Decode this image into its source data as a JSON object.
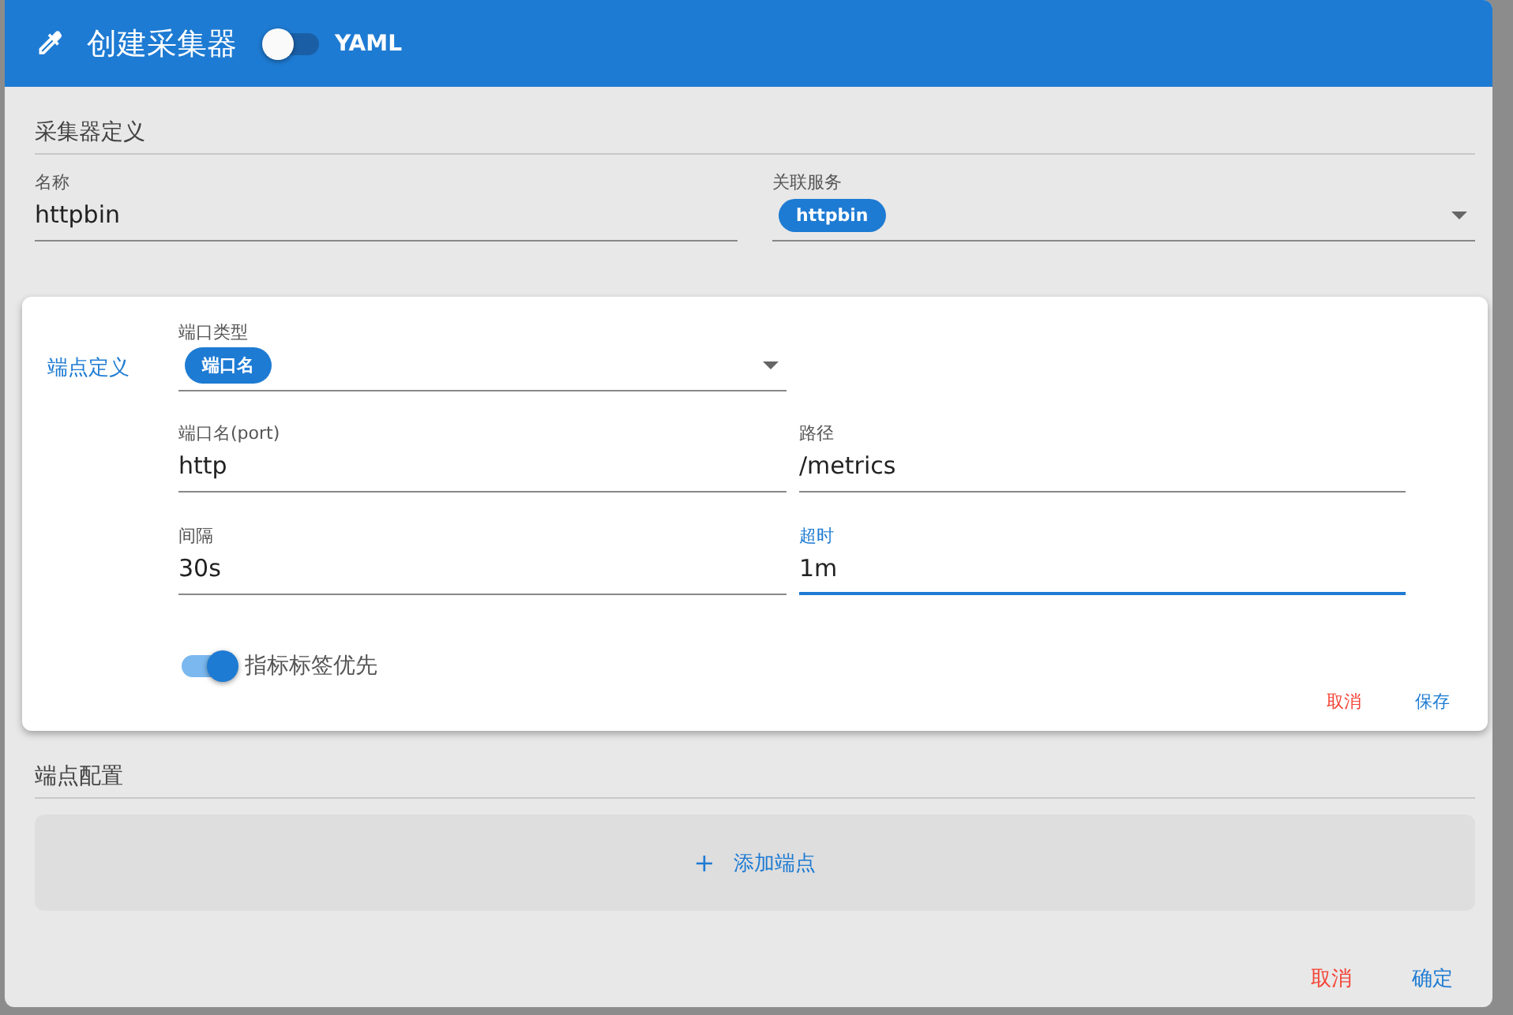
{
  "dialog": {
    "title": "创建采集器",
    "yaml_toggle": {
      "label": "YAML",
      "on": false
    }
  },
  "definition": {
    "heading": "采集器定义",
    "fields": [
      {
        "label": "名称",
        "value": "httpbin",
        "kind": "text"
      },
      {
        "label": "关联服务",
        "kind": "select",
        "chips": [
          "httpbin"
        ]
      }
    ]
  },
  "endpoint_card": {
    "label": "端点定义",
    "port_type": {
      "label": "端口类型",
      "chips": [
        "端口名"
      ]
    },
    "fields": [
      {
        "label": "端口名(port)",
        "value": "http",
        "focused": false
      },
      {
        "label": "路径",
        "value": "/metrics",
        "focused": false
      },
      {
        "label": "间隔",
        "value": "30s",
        "focused": false
      },
      {
        "label": "超时",
        "value": "1m",
        "focused": true
      }
    ],
    "switch": {
      "label": "指标标签优先",
      "on": true
    },
    "buttons": [
      {
        "label": "取消",
        "kind": "cancel"
      },
      {
        "label": "保存",
        "kind": "primary"
      }
    ]
  },
  "endpoints": {
    "heading": "端点配置",
    "add_button": {
      "icon": "+",
      "label": "添加端点"
    }
  },
  "buttons": [
    {
      "label": "取消",
      "kind": "cancel"
    },
    {
      "label": "确定",
      "kind": "primary"
    }
  ]
}
